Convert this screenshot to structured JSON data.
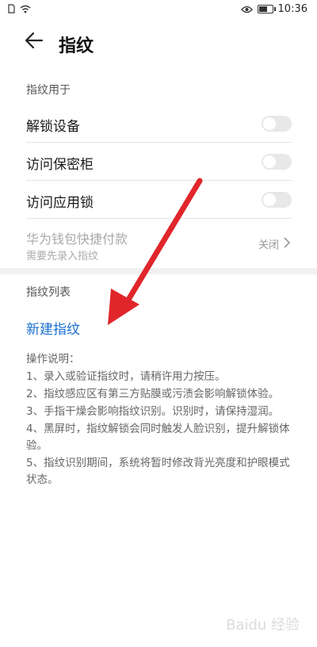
{
  "status_bar": {
    "time": "10:36",
    "icons": [
      "sim-icon",
      "wifi-icon",
      "eye-icon",
      "battery-icon"
    ]
  },
  "header": {
    "title": "指纹",
    "back_icon": "back-arrow-icon"
  },
  "section_use": {
    "label": "指纹用于",
    "items": [
      {
        "label": "解锁设备",
        "enabled": false
      },
      {
        "label": "访问保密柜",
        "enabled": false
      },
      {
        "label": "访问应用锁",
        "enabled": false
      }
    ],
    "payment": {
      "label": "华为钱包快捷付款",
      "sub": "需要先录入指纹",
      "value": "关闭"
    }
  },
  "section_list": {
    "label": "指纹列表",
    "new_label": "新建指纹"
  },
  "instructions": {
    "title": "操作说明：",
    "lines": [
      "1、录入或验证指纹时，请稍许用力按压。",
      "2、指纹感应区有第三方贴膜或污渍会影响解锁体验。",
      "3、手指干燥会影响指纹识别。识别时，请保持湿润。",
      "4、黑屏时，指纹解锁会同时触发人脸识别，提升解锁体验。",
      "5、指纹识别期间，系统将暂时修改背光亮度和护眼模式状态。"
    ]
  },
  "colors": {
    "accent": "#1b6fd1",
    "annotation_arrow": "#e0262b"
  },
  "watermark": "Baidu 经验"
}
